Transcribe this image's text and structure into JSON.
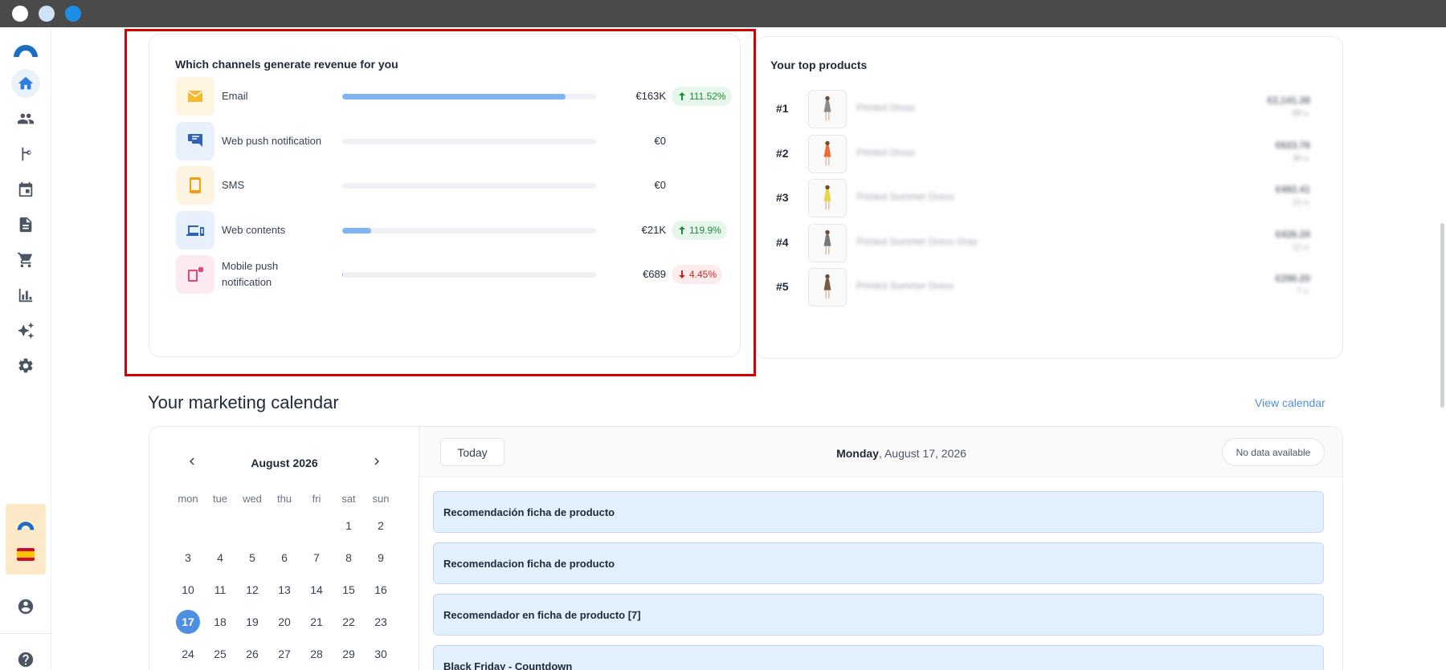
{
  "window": {
    "buttons": [
      "close",
      "minimize",
      "maximize"
    ]
  },
  "sidebar": {
    "items": [
      {
        "icon": "home-icon",
        "active": true
      },
      {
        "icon": "people-icon"
      },
      {
        "icon": "flow-icon"
      },
      {
        "icon": "calendar-icon"
      },
      {
        "icon": "document-icon"
      },
      {
        "icon": "cart-icon"
      },
      {
        "icon": "bar-chart-icon"
      },
      {
        "icon": "sparkles-icon"
      },
      {
        "icon": "gear-icon"
      }
    ],
    "bottom": [
      "brand-logo",
      "spain-flag-icon",
      "account-circle-icon",
      "help-icon"
    ]
  },
  "revenue": {
    "title": "Which channels generate revenue for you",
    "channels": [
      {
        "label": "Email",
        "value": "€163K",
        "change": "111.52%",
        "trend": "up",
        "share": 0.88,
        "icon": "email-icon",
        "color": "#f5b82e",
        "bg": "#fff5e0"
      },
      {
        "label": "Web push notification",
        "value": "€0",
        "change": "",
        "trend": "",
        "share": 0,
        "icon": "chat-icon",
        "color": "#2f62b4",
        "bg": "#e8f1fb"
      },
      {
        "label": "SMS",
        "value": "€0",
        "change": "",
        "trend": "",
        "share": 0,
        "icon": "phone-icon",
        "color": "#f59e0b",
        "bg": "#fff4e2"
      },
      {
        "label": "Web contents",
        "value": "€21K",
        "change": "119.9%",
        "trend": "up",
        "share": 0.115,
        "icon": "devices-icon",
        "color": "#2f62b4",
        "bg": "#e8f1fb"
      },
      {
        "label": "Mobile push\nnotification",
        "value": "€689",
        "change": "4.45%",
        "trend": "down",
        "share": 0.004,
        "icon": "mobile-push-icon",
        "color": "#e0467c",
        "bg": "#fdeaf1"
      }
    ]
  },
  "products": {
    "title": "Your top products",
    "items": [
      {
        "rank": "#1",
        "name": "Printed Dress",
        "price": "€2,141.38",
        "sub": "68 u.",
        "dress": "#8a8a8a"
      },
      {
        "rank": "#2",
        "name": "Printed Dress",
        "price": "€623.76",
        "sub": "38 u.",
        "dress": "#f06a3a"
      },
      {
        "rank": "#3",
        "name": "Printed Summer Dress",
        "price": "€482.41",
        "sub": "22 u.",
        "dress": "#e8d245"
      },
      {
        "rank": "#4",
        "name": "Printed Summer Dress Gray",
        "price": "€426.20",
        "sub": "12 u.",
        "dress": "#777777"
      },
      {
        "rank": "#5",
        "name": "Printed Summer Dress",
        "price": "€296.20",
        "sub": "7 u.",
        "dress": "#7a5a40"
      }
    ]
  },
  "calendar": {
    "section_title": "Your marketing calendar",
    "view_link": "View calendar",
    "month": "August 2026",
    "weekdays": [
      "mon",
      "tue",
      "wed",
      "thu",
      "fri",
      "sat",
      "sun"
    ],
    "weeks": [
      [
        "",
        "",
        "",
        "",
        "",
        "1",
        "2"
      ],
      [
        "3",
        "4",
        "5",
        "6",
        "7",
        "8",
        "9"
      ],
      [
        "10",
        "11",
        "12",
        "13",
        "14",
        "15",
        "16"
      ],
      [
        "17",
        "18",
        "19",
        "20",
        "21",
        "22",
        "23"
      ],
      [
        "24",
        "25",
        "26",
        "27",
        "28",
        "29",
        "30"
      ]
    ],
    "selected": "17",
    "today_label": "Today",
    "day_name": "Monday",
    "date_rest": ", August 17, 2026",
    "no_data": "No data available",
    "events": [
      "Recomendación ficha de producto",
      "Recomendacion ficha de producto",
      "Recomendador en ficha de producto [7]",
      "Black Friday - Countdown"
    ]
  }
}
